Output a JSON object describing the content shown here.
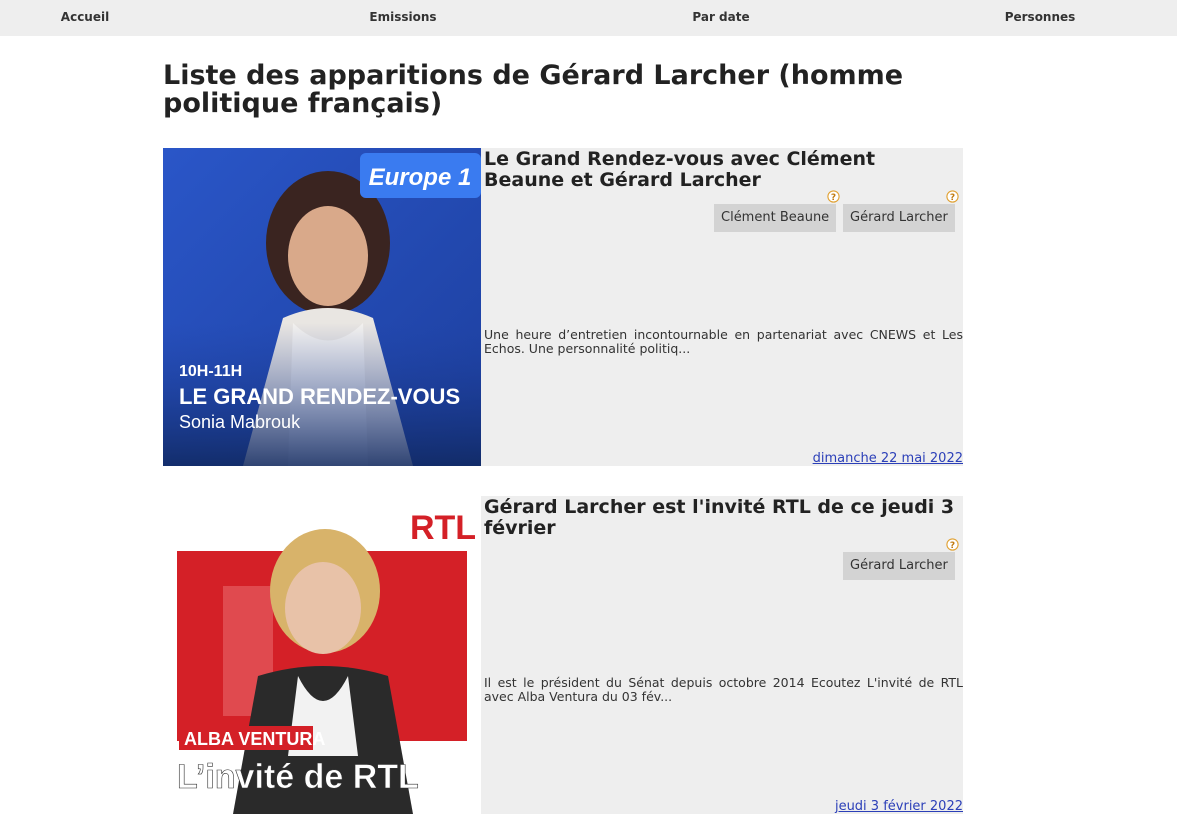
{
  "nav": {
    "home": "Accueil",
    "shows": "Emissions",
    "by_date": "Par date",
    "people": "Personnes"
  },
  "page_title": "Liste des apparitions de Gérard Larcher (homme politique français)",
  "episodes": [
    {
      "title": "Le Grand Rendez-vous avec Clément Beaune et Gérard Larcher",
      "people": [
        "Clément Beaune",
        "Gérard Larcher"
      ],
      "description": "Une heure d’entretien incontournable en partenariat avec CNEWS et Les Echos. Une personnalité politiq...",
      "date": "dimanche 22 mai 2022",
      "thumbnail": {
        "logo": "Europe 1",
        "time": "10H-11H",
        "show": "LE GRAND RENDEZ-VOUS",
        "host": "Sonia Mabrouk",
        "bg_color": "#2f5fd0"
      }
    },
    {
      "title": "Gérard Larcher est l'invité RTL de ce jeudi 3 février",
      "people": [
        "Gérard Larcher"
      ],
      "description": "Il est le président du Sénat depuis octobre 2014 Ecoutez L'invité de RTL avec Alba Ventura du 03 fév...",
      "date": "jeudi 3 février 2022",
      "thumbnail": {
        "logo": "RTL",
        "host": "ALBA VENTURA",
        "show": "L’invité de RTL",
        "bg_color": "#d42027"
      }
    }
  ],
  "colors": {
    "nav_bg": "#eeeeee",
    "card_bg": "#eeeeee",
    "chip_bg": "#d3d3d3",
    "link": "#2b3fb8",
    "help_icon": "#e0a030"
  }
}
